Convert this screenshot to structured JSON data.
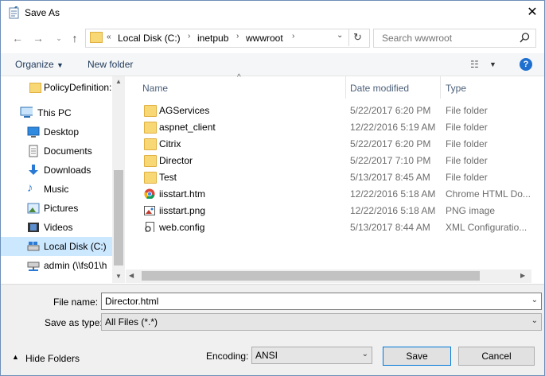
{
  "window": {
    "title": "Save As"
  },
  "nav": {
    "address": {
      "crumbs": [
        "Local Disk (C:)",
        "inetpub",
        "wwwroot"
      ]
    },
    "search_placeholder": "Search wwwroot"
  },
  "toolbar": {
    "organize": "Organize",
    "new_folder": "New folder"
  },
  "sidebar": {
    "items": [
      {
        "label": "PolicyDefinition:",
        "icon": "folder-icon"
      },
      {
        "label": "This PC",
        "icon": "computer-icon"
      },
      {
        "label": "Desktop",
        "icon": "desktop-icon"
      },
      {
        "label": "Documents",
        "icon": "documents-icon"
      },
      {
        "label": "Downloads",
        "icon": "downloads-icon"
      },
      {
        "label": "Music",
        "icon": "music-icon"
      },
      {
        "label": "Pictures",
        "icon": "pictures-icon"
      },
      {
        "label": "Videos",
        "icon": "videos-icon"
      },
      {
        "label": "Local Disk (C:)",
        "icon": "disk-icon",
        "selected": true
      },
      {
        "label": "admin (\\\\fs01\\h",
        "icon": "network-drive-icon"
      }
    ]
  },
  "filelist": {
    "columns": [
      "Name",
      "Date modified",
      "Type"
    ],
    "rows": [
      {
        "name": "AGServices",
        "date": "5/22/2017 6:20 PM",
        "type": "File folder",
        "icon": "folder-icon"
      },
      {
        "name": "aspnet_client",
        "date": "12/22/2016 5:19 AM",
        "type": "File folder",
        "icon": "folder-icon"
      },
      {
        "name": "Citrix",
        "date": "5/22/2017 6:20 PM",
        "type": "File folder",
        "icon": "folder-icon"
      },
      {
        "name": "Director",
        "date": "5/22/2017 7:10 PM",
        "type": "File folder",
        "icon": "folder-icon"
      },
      {
        "name": "Test",
        "date": "5/13/2017 8:45 AM",
        "type": "File folder",
        "icon": "folder-icon"
      },
      {
        "name": "iisstart.htm",
        "date": "12/22/2016 5:18 AM",
        "type": "Chrome HTML Do...",
        "icon": "chrome-icon"
      },
      {
        "name": "iisstart.png",
        "date": "12/22/2016 5:18 AM",
        "type": "PNG image",
        "icon": "image-icon"
      },
      {
        "name": "web.config",
        "date": "5/13/2017 8:44 AM",
        "type": "XML Configuratio...",
        "icon": "config-icon"
      }
    ]
  },
  "form": {
    "file_name_label": "File name:",
    "file_name_value": "Director.html",
    "save_as_type_label": "Save as type:",
    "save_as_type_value": "All Files  (*.*)",
    "encoding_label": "Encoding:",
    "encoding_value": "ANSI",
    "hide_folders": "Hide Folders",
    "save": "Save",
    "cancel": "Cancel"
  },
  "colors": {
    "accent": "#0078d7",
    "selection": "#cce8ff",
    "folder": "#f8d775"
  }
}
